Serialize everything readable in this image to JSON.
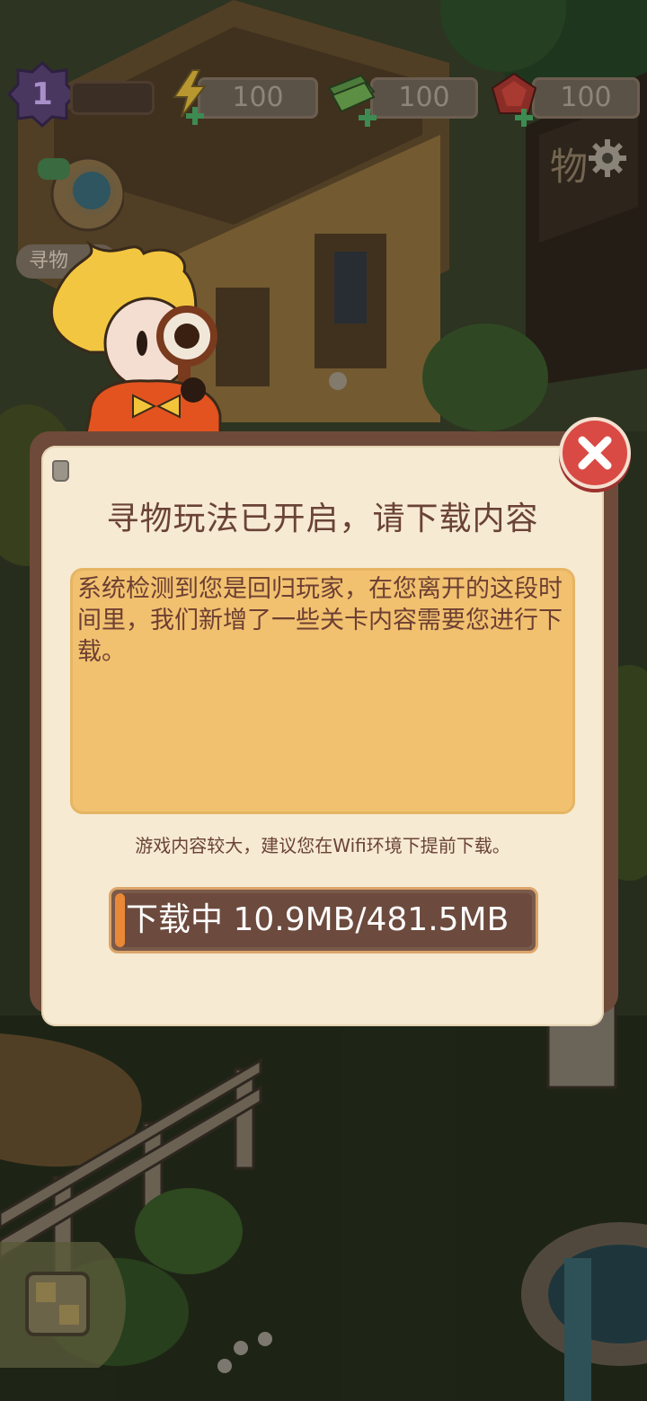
{
  "hud": {
    "level": "1",
    "energy": "100",
    "cash": "100",
    "gems": "100"
  },
  "side_button": {
    "label": "寻物"
  },
  "sign": {
    "text": "物"
  },
  "dialog": {
    "title": "寻物玩法已开启，请下载内容",
    "message": "系统检测到您是回归玩家，在您离开的这段时间里，我们新增了一些关卡内容需要您进行下载。",
    "hint": "游戏内容较大，建议您在Wifi环境下提前下载。",
    "progress": {
      "label": "下载中  10.9MB/481.5MB",
      "downloaded_mb": 10.9,
      "total_mb": 481.5
    }
  },
  "colors": {
    "dialog_frame": "#6e4a3a",
    "dialog_paper": "#f6ead2",
    "message_box": "#f1c170",
    "title_text": "#6a4336",
    "progress_fill": "#e98836",
    "close_button": "#d94a44"
  },
  "icons": {
    "close": "close-icon",
    "settings": "gear-icon",
    "energy": "lightning-icon",
    "cash": "cash-icon",
    "gems": "gem-icon"
  }
}
